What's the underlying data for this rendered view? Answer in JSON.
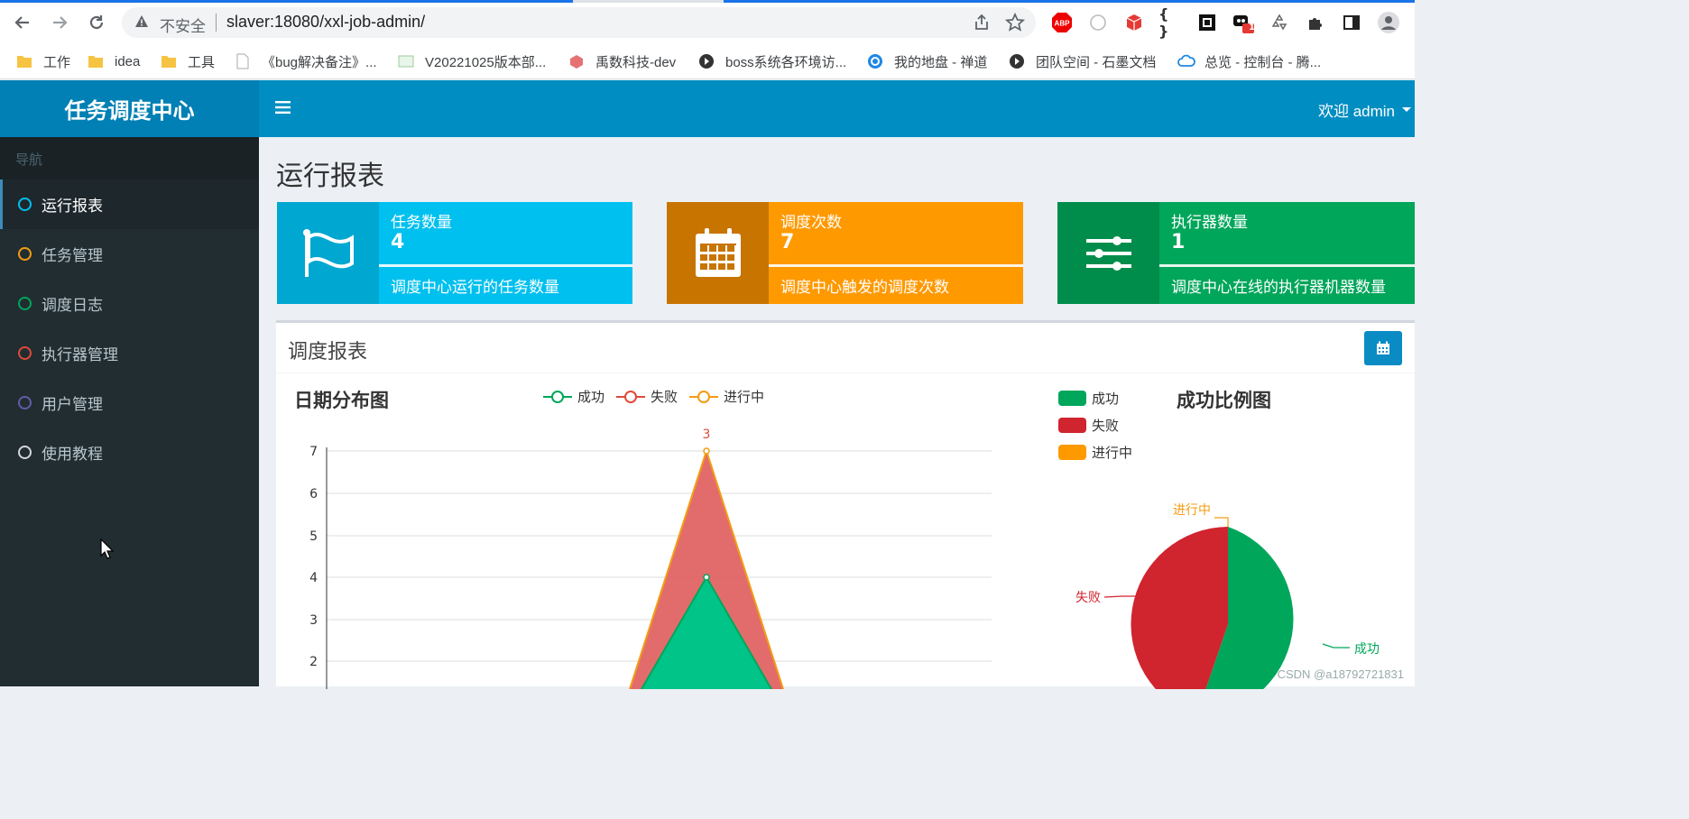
{
  "browser": {
    "insecure_label": "不安全",
    "url": "slaver:18080/xxl-job-admin/",
    "bookmarks": [
      {
        "label": "工作",
        "icon": "folder-icon"
      },
      {
        "label": "idea",
        "icon": "folder-icon"
      },
      {
        "label": "工具",
        "icon": "folder-icon"
      },
      {
        "label": "《bug解决备注》...",
        "icon": "doc-icon"
      },
      {
        "label": "V20221025版本部...",
        "icon": "sheet-icon"
      },
      {
        "label": "禹数科技-dev",
        "icon": "app-icon"
      },
      {
        "label": "boss系统各环境访...",
        "icon": "shimo-icon"
      },
      {
        "label": "我的地盘 - 禅道",
        "icon": "zentao-icon"
      },
      {
        "label": "团队空间 - 石墨文档",
        "icon": "shimo-icon"
      },
      {
        "label": "总览 - 控制台 - 腾...",
        "icon": "cloud-icon"
      }
    ],
    "ext_badge": "1"
  },
  "app": {
    "logo": "任务调度中心",
    "welcome": "欢迎 admin"
  },
  "sidebar": {
    "header": "导航",
    "items": [
      {
        "label": "运行报表",
        "color": "#00c0ef"
      },
      {
        "label": "任务管理",
        "color": "#f39c12"
      },
      {
        "label": "调度日志",
        "color": "#00a65a"
      },
      {
        "label": "执行器管理",
        "color": "#dd4b39"
      },
      {
        "label": "用户管理",
        "color": "#605ca8"
      },
      {
        "label": "使用教程",
        "color": "#d2d6de"
      }
    ]
  },
  "main": {
    "title": "运行报表",
    "cards": [
      {
        "label": "任务数量",
        "value": "4",
        "desc": "调度中心运行的任务数量",
        "bg": "#00c0ef",
        "icon_bg": "#00a7d0"
      },
      {
        "label": "调度次数",
        "value": "7",
        "desc": "调度中心触发的调度次数",
        "bg": "#ff9900",
        "icon_bg": "#c87400"
      },
      {
        "label": "执行器数量",
        "value": "1",
        "desc": "调度中心在线的执行器机器数量",
        "bg": "#00a65a",
        "icon_bg": "#008d4c"
      }
    ],
    "report": {
      "title": "调度报表",
      "line_chart_title": "日期分布图",
      "pie_chart_title": "成功比例图",
      "legend": [
        "成功",
        "失败",
        "进行中"
      ],
      "pie_labels": {
        "running": "进行中",
        "fail": "失败",
        "success": "成功"
      }
    }
  },
  "chart_data": [
    {
      "type": "area",
      "title": "日期分布图",
      "y_ticks": [
        2,
        3,
        4,
        5,
        6,
        7
      ],
      "peak_label": "3",
      "series": [
        {
          "name": "成功",
          "color": "#00a65a",
          "peak": 4
        },
        {
          "name": "失败",
          "color": "#dd4b39",
          "peak": 3
        },
        {
          "name": "进行中",
          "color": "#f39c12",
          "peak": 0
        }
      ]
    },
    {
      "type": "pie",
      "title": "成功比例图",
      "slices": [
        {
          "label": "成功",
          "value": 4,
          "color": "#00a65a"
        },
        {
          "label": "失败",
          "value": 3,
          "color": "#dd4b39"
        },
        {
          "label": "进行中",
          "value": 0,
          "color": "#f39c12"
        }
      ]
    }
  ],
  "watermark": "CSDN @a18792721831"
}
